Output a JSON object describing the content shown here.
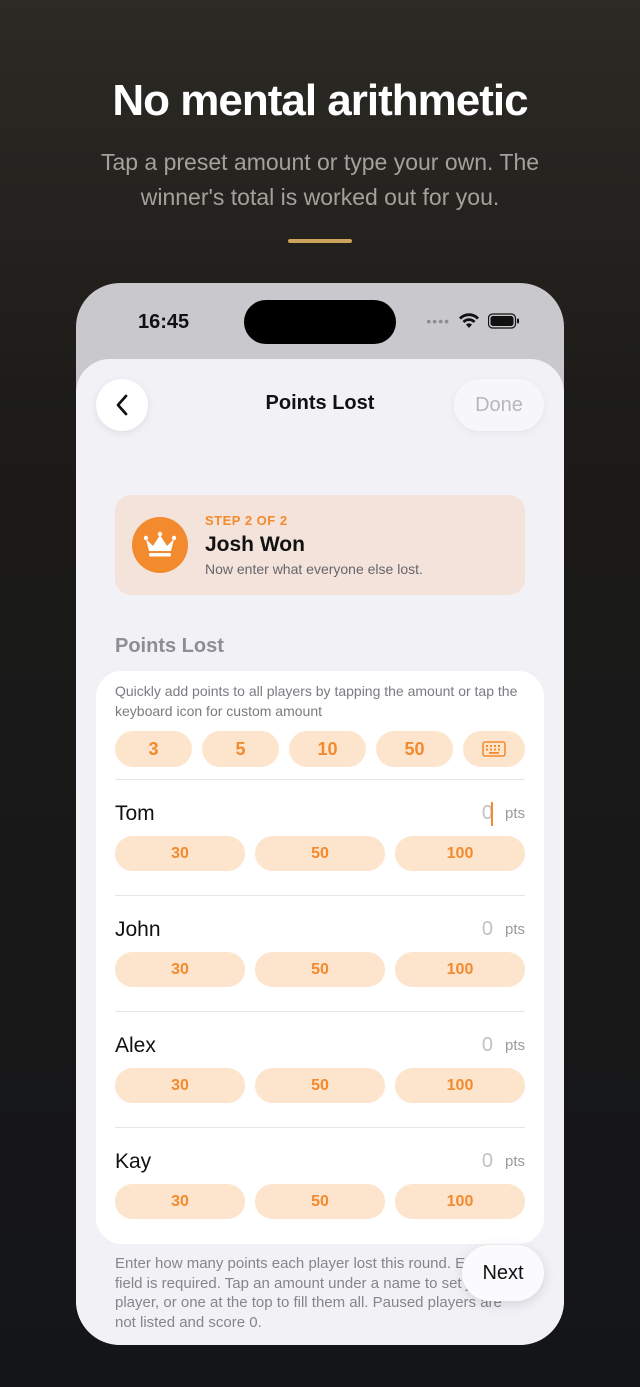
{
  "promo": {
    "headline": "No mental arithmetic",
    "subline": "Tap a preset amount or type your own. The winner's total is worked out for you.",
    "accent_color": "#c9a45a"
  },
  "status_bar": {
    "time": "16:45",
    "icons": [
      "signal-dots-icon",
      "wifi-icon",
      "battery-icon"
    ]
  },
  "nav": {
    "back_icon": "chevron-left-icon",
    "title": "Points Lost",
    "done_label": "Done"
  },
  "step_card": {
    "icon": "crown-icon",
    "step_label": "STEP 2 OF 2",
    "title": "Josh Won",
    "description": "Now enter what everyone else lost."
  },
  "section": {
    "title": "Points Lost",
    "hint": "Quickly add points to all players by tapping the amount or tap the keyboard icon for custom amount",
    "quick_amounts": [
      "3",
      "5",
      "10",
      "50"
    ],
    "keyboard_icon": "keyboard-icon"
  },
  "players": [
    {
      "name": "Tom",
      "value": "0",
      "unit": "pts",
      "presets": [
        "30",
        "50",
        "100"
      ],
      "focused": true
    },
    {
      "name": "John",
      "value": "0",
      "unit": "pts",
      "presets": [
        "30",
        "50",
        "100"
      ],
      "focused": false
    },
    {
      "name": "Alex",
      "value": "0",
      "unit": "pts",
      "presets": [
        "30",
        "50",
        "100"
      ],
      "focused": false
    },
    {
      "name": "Kay",
      "value": "0",
      "unit": "pts",
      "presets": [
        "30",
        "50",
        "100"
      ],
      "focused": false
    }
  ],
  "footer": {
    "note": "Enter how many points each player lost this round. Every field is required. Tap an amount under a name to set just that player, or one at the top to fill them all. Paused players are not listed and score 0.",
    "next_label": "Next"
  },
  "colors": {
    "accent_orange": "#f28a2e",
    "chip_bg": "#fde4cc",
    "card_bg": "#f3e3da"
  }
}
